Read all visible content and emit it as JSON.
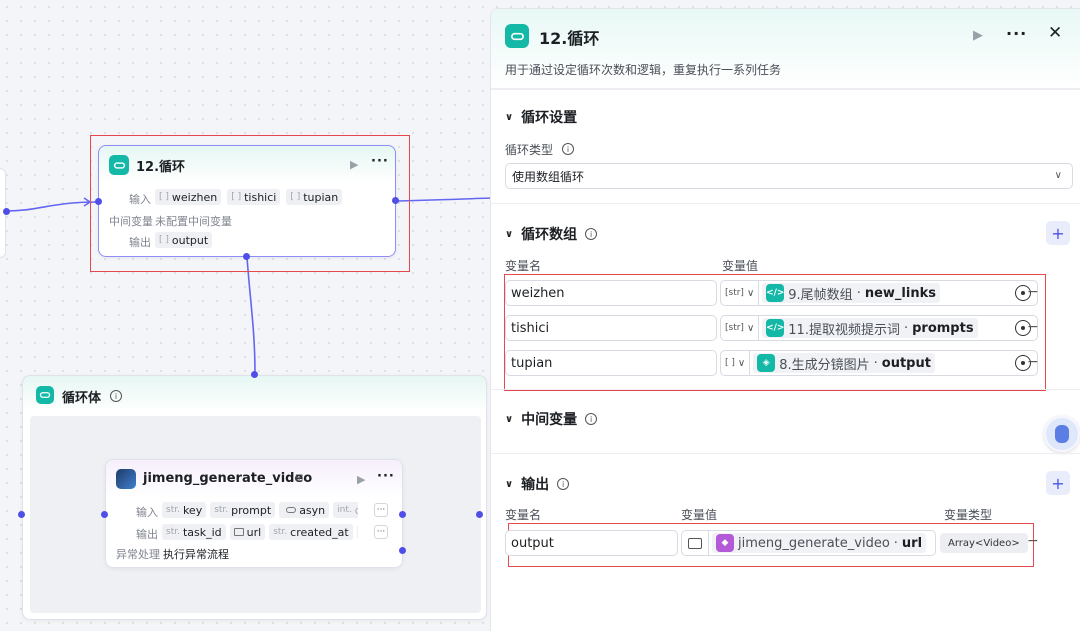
{
  "canvas": {
    "loop_node": {
      "title": "12.循环",
      "input_label": "输入",
      "inputs": [
        "weizhen",
        "tishici",
        "tupian"
      ],
      "input_type": "[ ]",
      "mid_label": "中间变量",
      "mid_value": "未配置中间变量",
      "output_label": "输出",
      "output": "output"
    },
    "loop_body": {
      "title": "循环体"
    },
    "jimeng_node": {
      "title": "jimeng_generate_video",
      "input_label": "输入",
      "inputs": [
        {
          "type": "str.",
          "name": "key"
        },
        {
          "type": "str.",
          "name": "prompt"
        },
        {
          "type": "",
          "name": "asyn"
        },
        {
          "type": "int.",
          "name": "durat"
        }
      ],
      "output_label": "输出",
      "outputs": [
        {
          "type": "str.",
          "name": "task_id"
        },
        {
          "type": "",
          "name": "url"
        },
        {
          "type": "str.",
          "name": "created_at"
        },
        {
          "type": "st",
          "name": ""
        }
      ],
      "error_label": "异常处理",
      "error_value": "执行异常流程"
    }
  },
  "panel": {
    "title": "12.循环",
    "description": "用于通过设定循环次数和逻辑，重复执行一系列任务",
    "settings": {
      "title": "循环设置",
      "type_label": "循环类型",
      "type_value": "使用数组循环"
    },
    "array": {
      "title": "循环数组",
      "col_name": "变量名",
      "col_value": "变量值",
      "rows": [
        {
          "name": "weizhen",
          "type": "[str]",
          "source": "9.尾帧数组",
          "sep": " · ",
          "var": "new_links"
        },
        {
          "name": "tishici",
          "type": "[str]",
          "source": "11.提取视频提示词",
          "sep": " · ",
          "var": "prompts"
        },
        {
          "name": "tupian",
          "type": "[ ]",
          "source": "8.生成分镜图片",
          "sep": " · ",
          "var": "output"
        }
      ]
    },
    "intermediate": {
      "title": "中间变量"
    },
    "output": {
      "title": "输出",
      "col_name": "变量名",
      "col_value": "变量值",
      "col_type": "变量类型",
      "row": {
        "name": "output",
        "source": "jimeng_generate_video",
        "sep": " · ",
        "var": "url",
        "type": "Array<Video>"
      }
    }
  },
  "colors": {
    "accent": "#4d53e8",
    "teal": "#14b8a6",
    "highlight": "#e5484d",
    "purple": "#b45ad9"
  }
}
